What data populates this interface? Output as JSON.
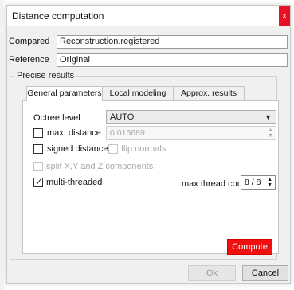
{
  "window": {
    "title": "Distance computation",
    "close_label": "x"
  },
  "fields": {
    "compared_label": "Compared",
    "compared_value": "Reconstruction.registered",
    "reference_label": "Reference",
    "reference_value": "Original"
  },
  "group_title": "Precise results",
  "tabs": [
    {
      "label": "General parameters",
      "active": true
    },
    {
      "label": "Local modeling",
      "active": false
    },
    {
      "label": "Approx. results",
      "active": false
    }
  ],
  "general": {
    "octree_label": "Octree level",
    "octree_value": "AUTO",
    "max_distance_label": "max. distance",
    "max_distance_checked": false,
    "max_distance_value": "0.015689",
    "signed_label": "signed distances",
    "signed_checked": false,
    "flip_label": "flip normals",
    "split_label": "split X,Y and Z components",
    "multithreaded_label": "multi-threaded",
    "multithreaded_checked": true,
    "max_thread_label": "max thread count",
    "max_thread_value": "8 / 8"
  },
  "buttons": {
    "compute": "Compute",
    "ok": "Ok",
    "cancel": "Cancel"
  },
  "colors": {
    "compute_bg": "#f10f0f",
    "close_bg": "#e81123"
  }
}
